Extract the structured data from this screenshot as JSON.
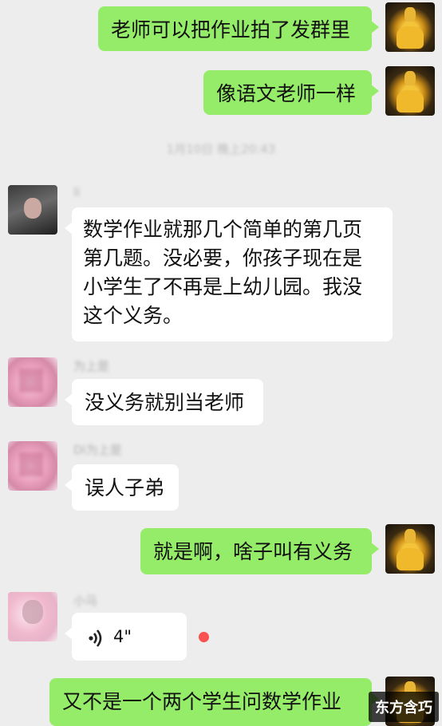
{
  "messages": [
    {
      "id": "m1",
      "side": "right",
      "text": "老师可以把作业拍了发群里"
    },
    {
      "id": "m2",
      "side": "right",
      "text": "像语文老师一样"
    },
    {
      "id": "m3",
      "side": "left",
      "nickname": "li",
      "lines": [
        "数学作业就那几个简单的第几页",
        "第几题。没必要，你孩子现在是",
        "小学生了不再是上幼儿园。我没",
        "这个义务。"
      ]
    },
    {
      "id": "m4",
      "side": "left",
      "nickname": "为上是",
      "text": "没义务就别当老师"
    },
    {
      "id": "m5",
      "side": "left",
      "nickname": "Di为上是",
      "text": "误人子弟"
    },
    {
      "id": "m6",
      "side": "right",
      "text": "就是啊，啥子叫有义务"
    },
    {
      "id": "m7",
      "side": "left",
      "nickname": "小马",
      "voice_duration": "4\"",
      "unread": true
    },
    {
      "id": "m8",
      "side": "right",
      "text": "又不是一个两个学生问数学作业"
    }
  ],
  "timestamp": "1月10日 晚上20:43",
  "watermark": "东方含巧",
  "colors": {
    "background": "#ededed",
    "sent_bubble": "#95ec69",
    "received_bubble": "#ffffff",
    "unread_dot": "#fa5151"
  }
}
